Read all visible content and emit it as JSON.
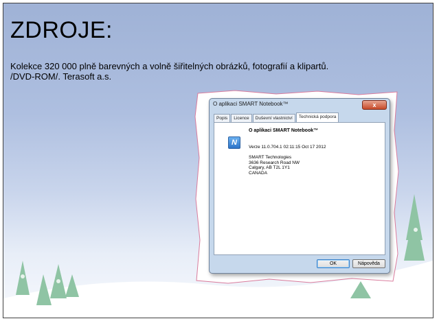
{
  "slide": {
    "title": "ZDROJE:",
    "body_lines": [
      "Kolekce 320 000 plně barevných a volně šiřitelných obrázků, fotografií a klipartů.",
      "/DVD-ROM/. Terasoft a.s."
    ]
  },
  "dialog": {
    "title": "O aplikaci SMART Notebook™",
    "close_label": "x",
    "tabs": [
      "Popis",
      "Licence",
      "Duševní vlastnictví",
      "Technická podpora"
    ],
    "active_tab": "Technická podpora",
    "heading": "O aplikaci SMART Notebook™",
    "version": "Verze 11.0.704.1 02:11:15 Oct 17 2012",
    "address_lines": [
      "SMART Technologies",
      "3636 Research Road NW",
      "Calgary, AB T2L 1Y1",
      "CANADA"
    ],
    "ok_label": "OK",
    "help_label": "Nápověda"
  },
  "icons": {
    "app": "smart-notebook-icon",
    "close": "close-icon"
  },
  "colors": {
    "sky_top": "#9fb2d6",
    "close_red": "#c74a2a",
    "tree_green": "#8fc4a4"
  }
}
